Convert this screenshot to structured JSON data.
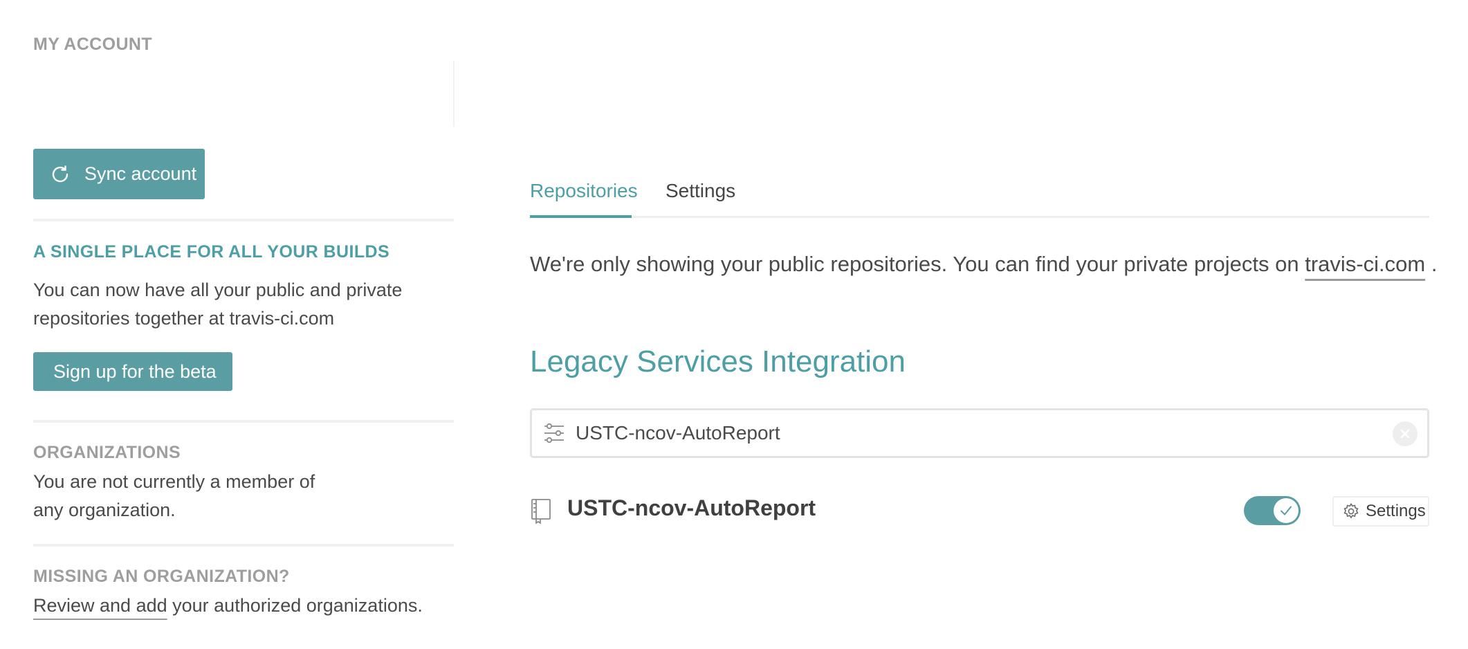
{
  "sidebar": {
    "my_account_title": "MY ACCOUNT",
    "sync_button_label": "Sync account",
    "builds_heading": "A SINGLE PLACE FOR ALL YOUR BUILDS",
    "builds_text_line1": "You can now have all your public and private",
    "builds_text_line2": "repositories together at travis-ci.com",
    "beta_button_label": "Sign up for the beta",
    "orgs_heading": "ORGANIZATIONS",
    "orgs_text_line1": "You are not currently a member of",
    "orgs_text_line2": "any organization.",
    "missing_heading": "MISSING AN ORGANIZATION?",
    "missing_link": "Review and add",
    "missing_text": " your authorized organizations."
  },
  "main": {
    "tabs": [
      {
        "label": "Repositories",
        "active": true
      },
      {
        "label": "Settings",
        "active": false
      }
    ],
    "notice_text": "We're only showing your public repositories. You can find your private projects on ",
    "notice_link": "travis-ci.com",
    "notice_suffix": " .",
    "legacy_title": "Legacy Services Integration",
    "filter": {
      "value": "USTC-ncov-AutoReport",
      "icon": "filter-sliders-icon",
      "clear_icon": "clear-icon"
    },
    "repo": {
      "name": "USTC-ncov-AutoReport",
      "icon": "repo-book-icon",
      "enabled": true,
      "settings_label": "Settings"
    }
  },
  "colors": {
    "accent": "#4c9fa5",
    "button": "#5a9ea3",
    "muted_heading": "#9e9e9e",
    "text": "#4a4a4a"
  }
}
